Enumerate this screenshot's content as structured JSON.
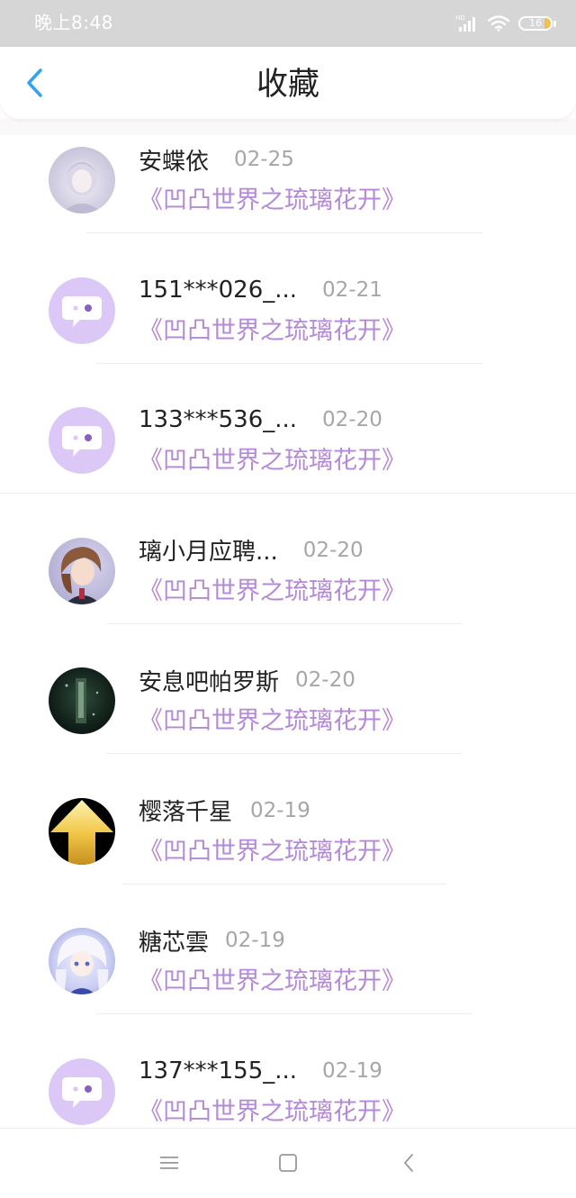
{
  "status_bar": {
    "time": "晚上8:48",
    "battery_level": "16",
    "icons": [
      "hd-signal-icon",
      "wifi-icon",
      "battery-icon"
    ]
  },
  "header": {
    "title": "收藏",
    "back_icon": "chevron-left-icon"
  },
  "colors": {
    "accent_blue": "#2ea3f2",
    "title_purple": "#b489d6",
    "default_avatar_bg": "#dcc8f7"
  },
  "favorites": [
    {
      "name": "安蝶依",
      "date": "02-25",
      "work": "《凹凸世界之琉璃花开》",
      "avatar": "anime-girl-pale-avatar"
    },
    {
      "name": "151***026_...",
      "date": "02-21",
      "work": "《凹凸世界之琉璃花开》",
      "avatar": "default-chat-bubble-avatar"
    },
    {
      "name": "133***536_...",
      "date": "02-20",
      "work": "《凹凸世界之琉璃花开》",
      "avatar": "default-chat-bubble-avatar"
    },
    {
      "name": "璃小月应聘...",
      "date": "02-20",
      "work": "《凹凸世界之琉璃花开》",
      "avatar": "anime-girl-brown-hair-avatar"
    },
    {
      "name": "安息吧帕罗斯",
      "date": "02-20",
      "work": "《凹凸世界之琉璃花开》",
      "avatar": "dark-green-scene-avatar"
    },
    {
      "name": "樱落千星",
      "date": "02-19",
      "work": "《凹凸世界之琉璃花开》",
      "avatar": "gold-arrow-avatar"
    },
    {
      "name": "糖芯雲",
      "date": "02-19",
      "work": "《凹凸世界之琉璃花开》",
      "avatar": "anime-girl-white-hair-avatar"
    },
    {
      "name": "137***155_...",
      "date": "02-19",
      "work": "《凹凸世界之琉璃花开》",
      "avatar": "default-chat-bubble-avatar"
    }
  ],
  "nav_bar": {
    "buttons": [
      "menu-icon",
      "home-square-icon",
      "back-triangle-icon"
    ]
  }
}
